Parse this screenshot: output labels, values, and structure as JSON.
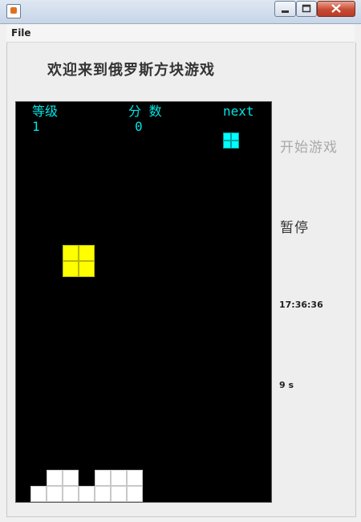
{
  "window": {
    "icon": "java-cup-icon",
    "controls": [
      "minimize-icon",
      "maximize-icon",
      "close-icon"
    ]
  },
  "menu": {
    "file_label": "File"
  },
  "header": {
    "title": "欢迎来到俄罗斯方块游戏"
  },
  "hud": {
    "level_label": "等级",
    "level_value": "1",
    "score_label": "分 数",
    "score_value": "0",
    "next_label": "next"
  },
  "pieces": {
    "current": {
      "shape": "O",
      "color": "#ffff00"
    },
    "next": {
      "shape": "O",
      "color": "#00ffff"
    }
  },
  "stack": {
    "color": "#ffffff"
  },
  "controls": {
    "start_label": "开始游戏",
    "start_enabled": false,
    "pause_label": "暂停"
  },
  "status": {
    "clock": "17:36:36",
    "elapsed": "9 s"
  },
  "colors": {
    "board_bg": "#000000",
    "hud_text": "#00e5e5"
  }
}
